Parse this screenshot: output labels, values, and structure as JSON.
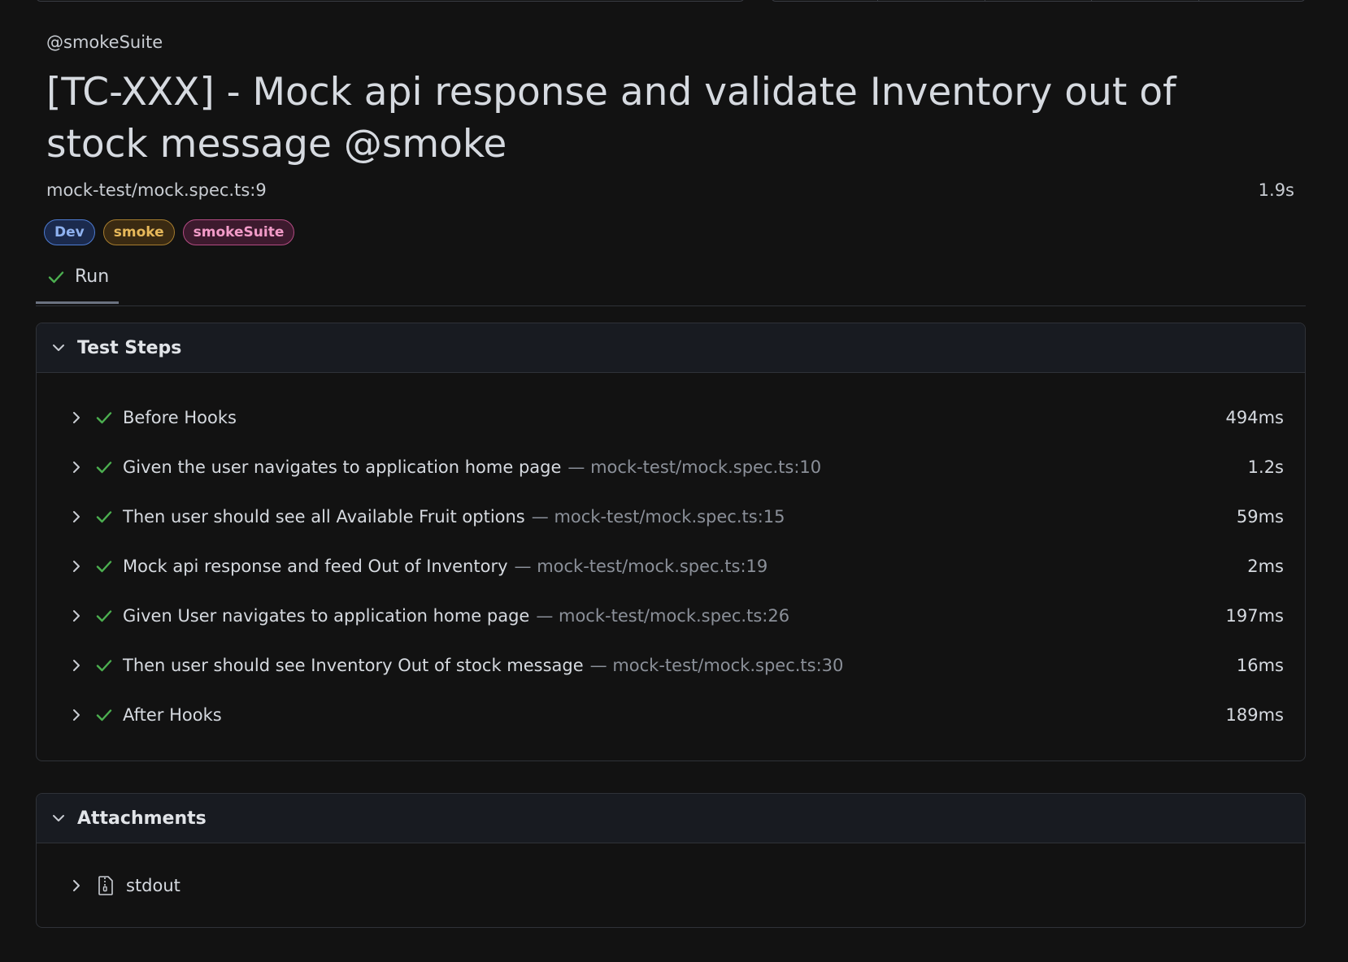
{
  "project": "@smokeSuite",
  "title": "[TC-XXX] - Mock api response and validate Inventory out of stock message @smoke",
  "location": "mock-test/mock.spec.ts:9",
  "duration": "1.9s",
  "tags": [
    {
      "label": "Dev",
      "color": "#8fb2f0"
    },
    {
      "label": "smoke",
      "color": "#e6b85a"
    },
    {
      "label": "smokeSuite",
      "color": "#f29bc8"
    }
  ],
  "tabs": [
    {
      "label": "Run",
      "status": "passed"
    }
  ],
  "test_steps": {
    "title": "Test Steps",
    "steps": [
      {
        "title": "Before Hooks",
        "location": "",
        "duration": "494ms",
        "status": "passed"
      },
      {
        "title": "Given the user navigates to application home page",
        "location": "— mock-test/mock.spec.ts:10",
        "duration": "1.2s",
        "status": "passed"
      },
      {
        "title": "Then user should see all Available Fruit options",
        "location": "— mock-test/mock.spec.ts:15",
        "duration": "59ms",
        "status": "passed"
      },
      {
        "title": "Mock api response and feed Out of Inventory",
        "location": "— mock-test/mock.spec.ts:19",
        "duration": "2ms",
        "status": "passed"
      },
      {
        "title": "Given User navigates to application home page",
        "location": "— mock-test/mock.spec.ts:26",
        "duration": "197ms",
        "status": "passed"
      },
      {
        "title": "Then user should see Inventory Out of stock message",
        "location": "— mock-test/mock.spec.ts:30",
        "duration": "16ms",
        "status": "passed"
      },
      {
        "title": "After Hooks",
        "location": "",
        "duration": "189ms",
        "status": "passed"
      }
    ]
  },
  "attachments": {
    "title": "Attachments",
    "items": [
      {
        "name": "stdout",
        "icon": "file-zip-icon"
      }
    ]
  },
  "colors": {
    "success": "#4caf50",
    "background": "#121212",
    "panel_header": "#181b21"
  }
}
